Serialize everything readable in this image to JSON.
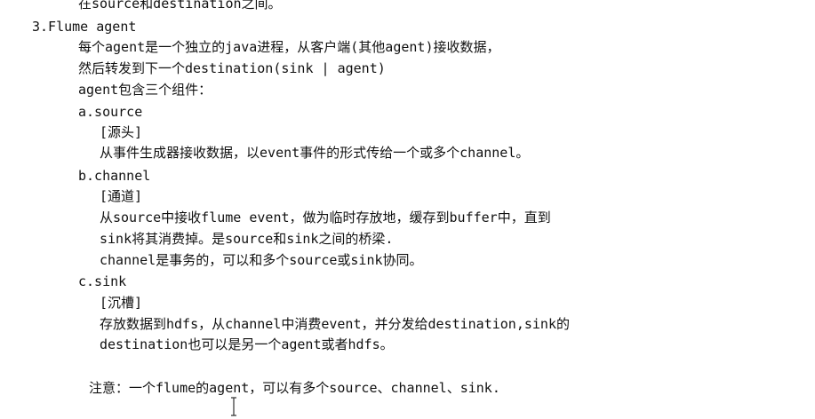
{
  "document": {
    "lines": [
      "在source和destination之间。",
      "3.Flume agent",
      "每个agent是一个独立的java进程，从客户端(其他agent)接收数据，",
      "然后转发到下一个destination(sink | agent)",
      "agent包含三个组件：",
      "a.source",
      "[源头]",
      "从事件生成器接收数据，以event事件的形式传给一个或多个channel。",
      "b.channel",
      "[通道]",
      "从source中接收flume event，做为临时存放地，缓存到buffer中，直到",
      "sink将其消费掉。是source和sink之间的桥梁.",
      "channel是事务的，可以和多个source或sink协同。",
      "c.sink",
      "[沉槽]",
      "存放数据到hdfs，从channel中消费event，并分发给destination,sink的",
      "destination也可以是另一个agent或者hdfs。",
      "注意：一个flume的agent，可以有多个source、channel、sink."
    ]
  }
}
